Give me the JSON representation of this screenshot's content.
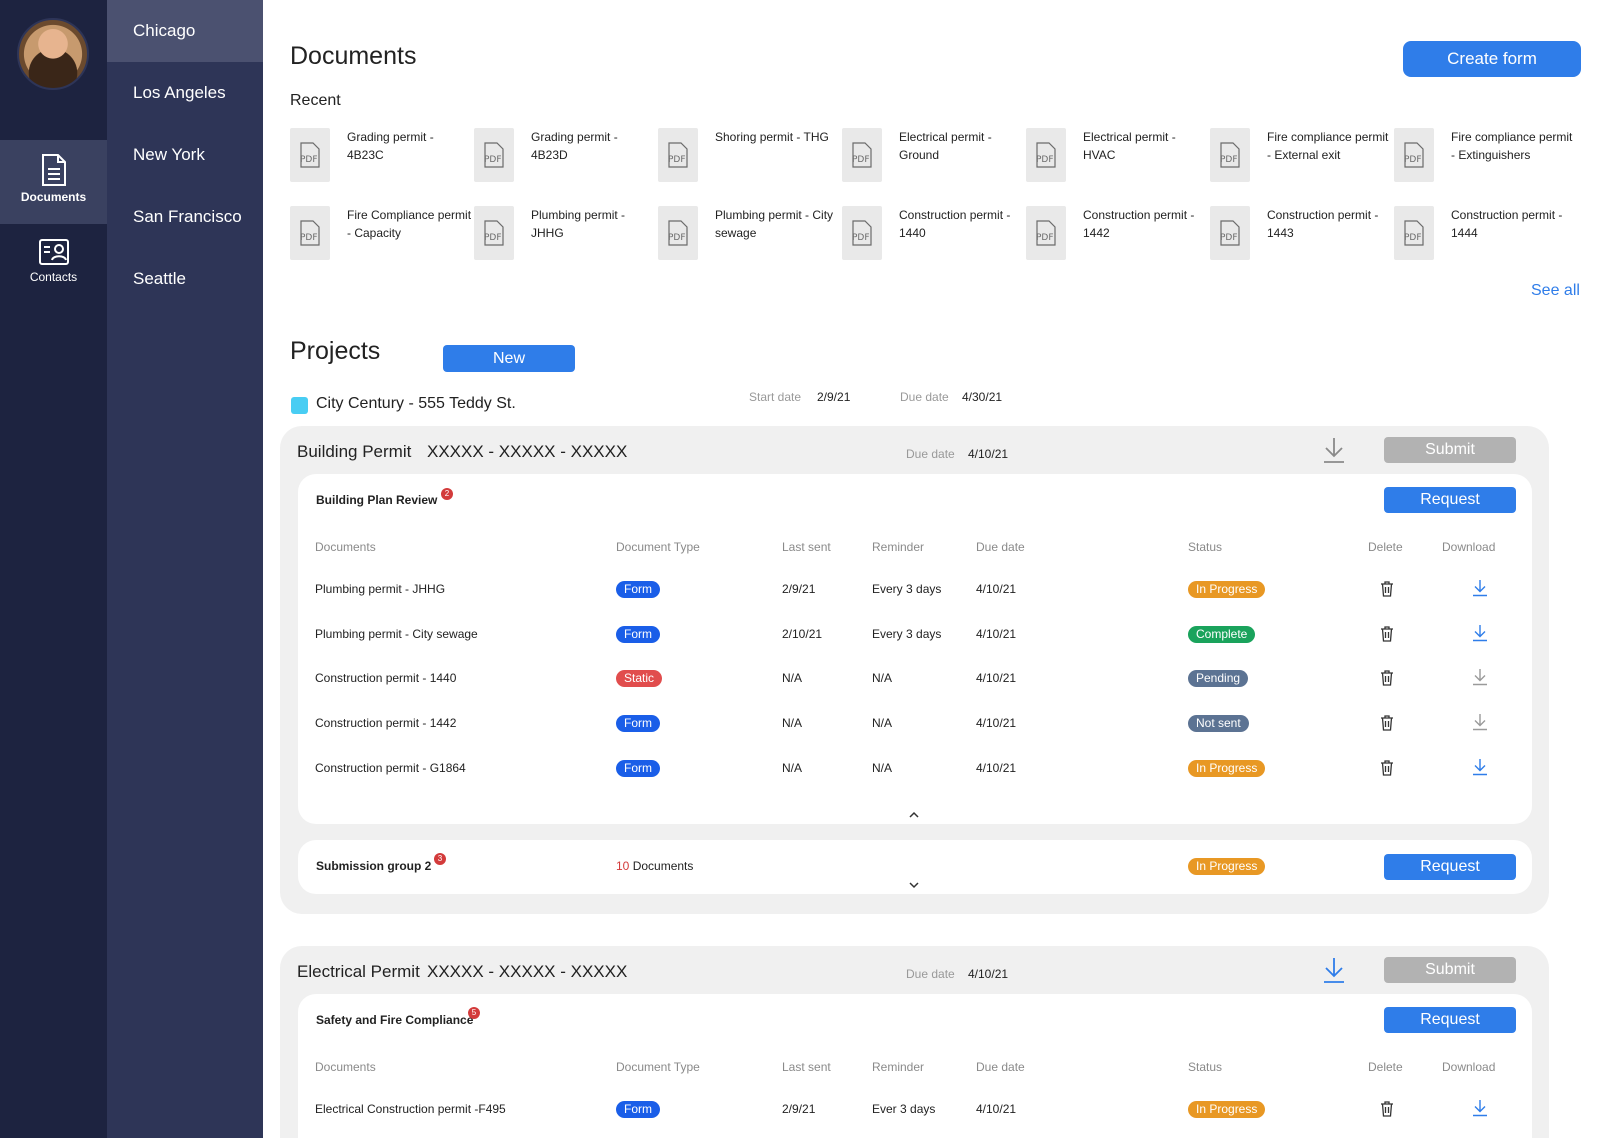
{
  "rail": {
    "items": [
      {
        "label": "Documents",
        "icon": "document-icon",
        "active": true
      },
      {
        "label": "Contacts",
        "icon": "contact-card-icon",
        "active": false
      }
    ]
  },
  "cities": [
    "Chicago",
    "Los Angeles",
    "New York",
    "San Francisco",
    "Seattle"
  ],
  "header": {
    "title": "Documents",
    "create_label": "Create form",
    "recent_label": "Recent",
    "see_all": "See all"
  },
  "recent_docs": [
    "Grading permit - 4B23C",
    "Grading permit - 4B23D",
    "Shoring permit - THG",
    "Electrical permit - Ground",
    "Electrical permit - HVAC",
    "Fire compliance permit - External exit",
    "Fire compliance permit - Extinguishers",
    "Fire Compliance permit - Capacity",
    "Plumbing permit - JHHG",
    "Plumbing permit - City sewage",
    "Construction permit - 1440",
    "Construction permit - 1442",
    "Construction permit - 1443",
    "Construction permit - 1444"
  ],
  "pdf_label": "PDF",
  "projects": {
    "title": "Projects",
    "new_label": "New",
    "project_name": "City Century - 555 Teddy St.",
    "start_label": "Start date",
    "start_value": "2/9/21",
    "due_label": "Due date",
    "due_value": "4/30/21",
    "swatch_color": "#48cdf3"
  },
  "table_headers": [
    "Documents",
    "Document Type",
    "Last sent",
    "Reminder",
    "Due date",
    "Status",
    "Delete",
    "Download"
  ],
  "building_permit": {
    "title": "Building Permit",
    "code": "XXXXX - XXXXX - XXXXX",
    "due_label": "Due date",
    "due_value": "4/10/21",
    "submit_label": "Submit",
    "group": {
      "title": "Building Plan Review",
      "count": "2",
      "request_label": "Request",
      "rows": [
        {
          "doc": "Plumbing permit - JHHG",
          "type": "Form",
          "last_sent": "2/9/21",
          "reminder": "Every 3 days",
          "due": "4/10/21",
          "status": "In Progress"
        },
        {
          "doc": "Plumbing permit - City sewage",
          "type": "Form",
          "last_sent": "2/10/21",
          "reminder": "Every 3 days",
          "due": "4/10/21",
          "status": "Complete"
        },
        {
          "doc": "Construction permit - 1440",
          "type": "Static",
          "last_sent": "N/A",
          "reminder": "N/A",
          "due": "4/10/21",
          "status": "Pending"
        },
        {
          "doc": "Construction permit - 1442",
          "type": "Form",
          "last_sent": "N/A",
          "reminder": "N/A",
          "due": "4/10/21",
          "status": "Not sent"
        },
        {
          "doc": "Construction permit - G1864",
          "type": "Form",
          "last_sent": "N/A",
          "reminder": "N/A",
          "due": "4/10/21",
          "status": "In Progress"
        }
      ]
    },
    "group2": {
      "title": "Submission group 2",
      "count": "3",
      "docs_count": "10",
      "docs_label": "Documents",
      "status": "In Progress",
      "request_label": "Request"
    }
  },
  "electrical_permit": {
    "title": "Electrical Permit",
    "code": "XXXXX - XXXXX - XXXXX",
    "due_label": "Due date",
    "due_value": "4/10/21",
    "submit_label": "Submit",
    "group": {
      "title": "Safety and Fire Compliance",
      "count": "5",
      "request_label": "Request",
      "rows": [
        {
          "doc": "Electrical Construction permit -F495",
          "type": "Form",
          "last_sent": "2/9/21",
          "reminder": "Ever 3 days",
          "due": "4/10/21",
          "status": "In Progress"
        }
      ]
    }
  },
  "colors": {
    "accent": "#2f7de9",
    "rail": "#1d2340",
    "sidebar": "#2e3557",
    "form": "#1a5ee8",
    "static": "#e14d4d",
    "in_progress": "#e89824",
    "complete": "#1aa35c",
    "pending": "#5c7393"
  }
}
